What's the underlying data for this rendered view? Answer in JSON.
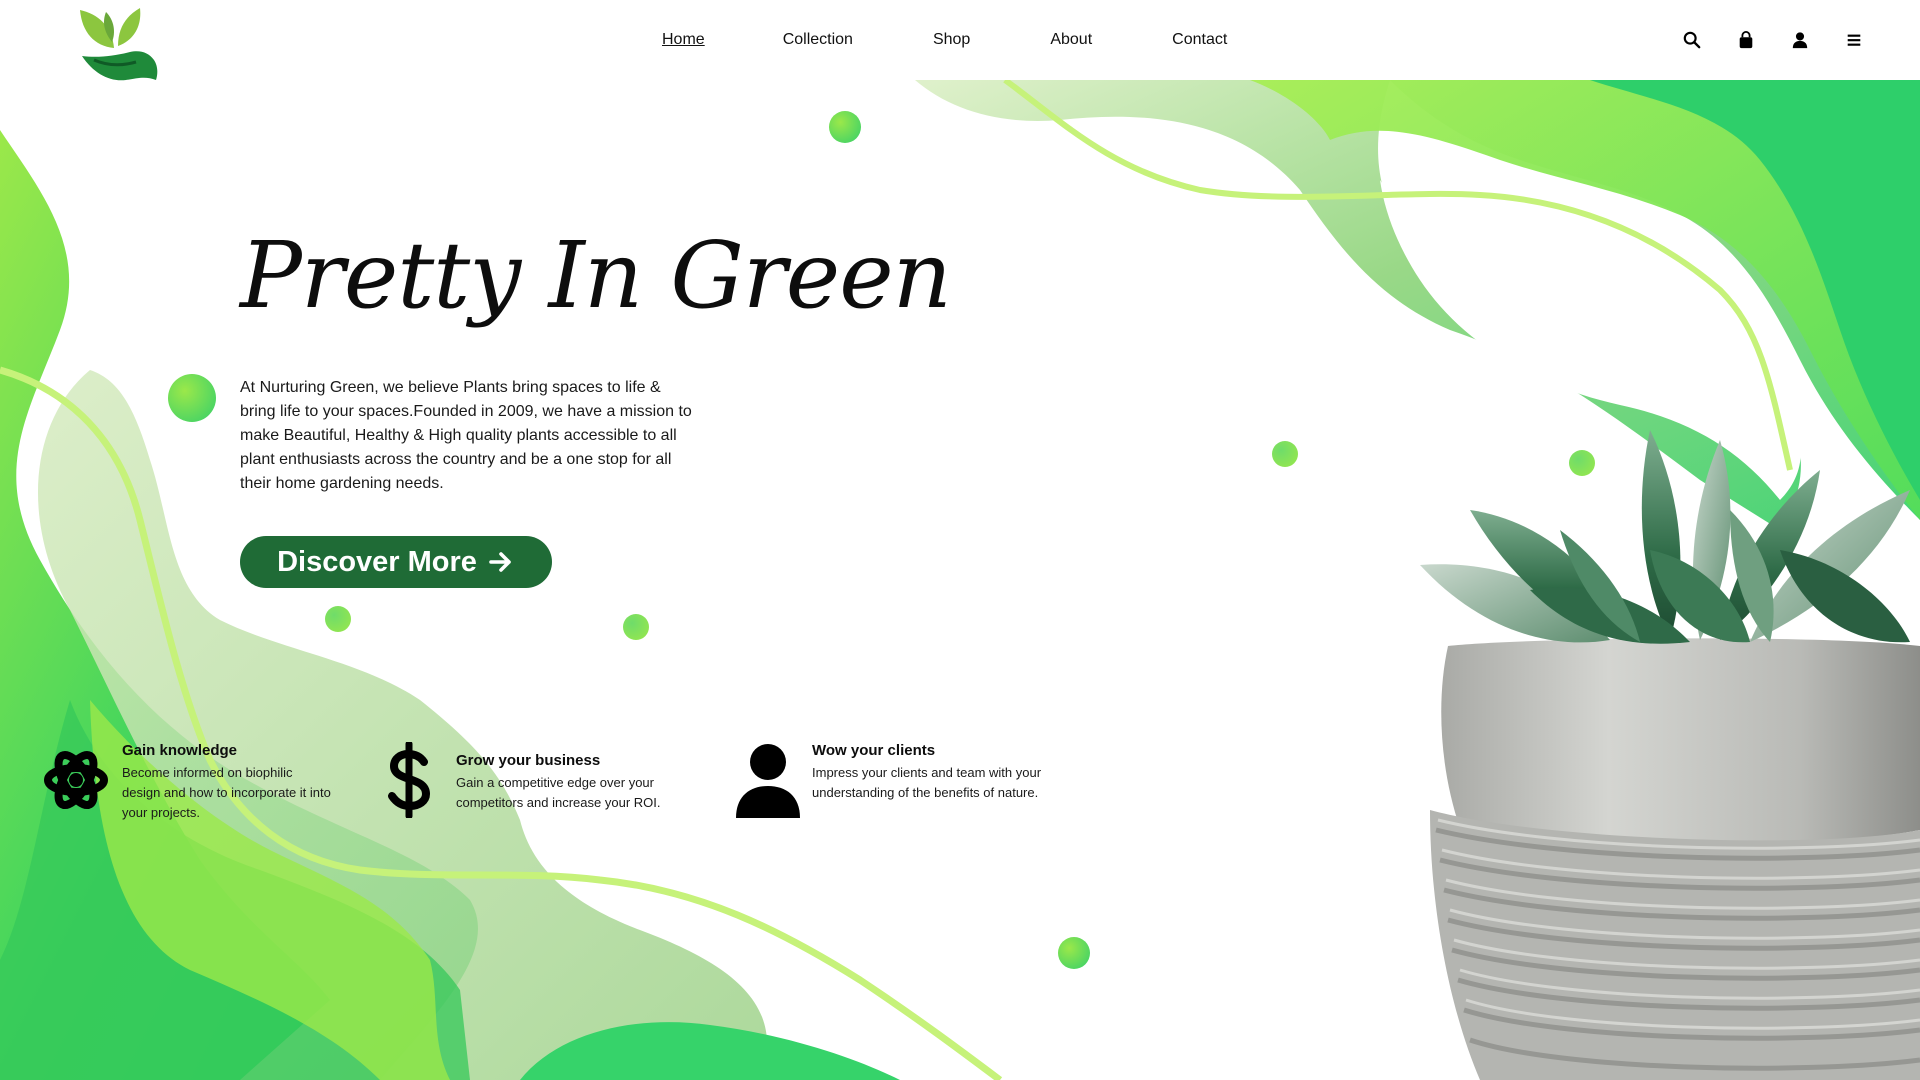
{
  "nav": {
    "links": [
      {
        "label": "Home",
        "active": true
      },
      {
        "label": "Collection",
        "active": false
      },
      {
        "label": "Shop",
        "active": false
      },
      {
        "label": "About",
        "active": false
      },
      {
        "label": "Contact",
        "active": false
      }
    ],
    "icons": [
      "search-icon",
      "shopping-bag-icon",
      "user-icon",
      "menu-icon"
    ]
  },
  "logo": {
    "icon": "leaf-hand-logo"
  },
  "hero": {
    "title": "Pretty In Green",
    "description": "At Nurturing Green, we believe Plants bring spaces to life & bring life to your spaces.Founded in 2009, we have a mission to make Beautiful, Healthy & High quality plants accessible to all plant enthusiasts across the country and be a one stop for all their home gardening needs.",
    "cta_label": "Discover More",
    "cta_icon": "arrow-right-icon"
  },
  "features": [
    {
      "icon": "atom-icon",
      "title": "Gain knowledge",
      "description": "Become informed on biophilic design and how to incorporate it into your projects."
    },
    {
      "icon": "dollar-icon",
      "title": "Grow your business",
      "description": "Gain a competitive edge over your competitors and increase your ROI."
    },
    {
      "icon": "person-icon",
      "title": "Wow your clients",
      "description": "Impress your clients and team with your understanding of the benefits of nature."
    }
  ],
  "colors": {
    "brand_dark_green": "#1f6b36",
    "lime": "#9be84a",
    "bright_green": "#2fd366",
    "pale_green": "#d4e8b8"
  },
  "product_image": "succulent-in-concrete-pot"
}
